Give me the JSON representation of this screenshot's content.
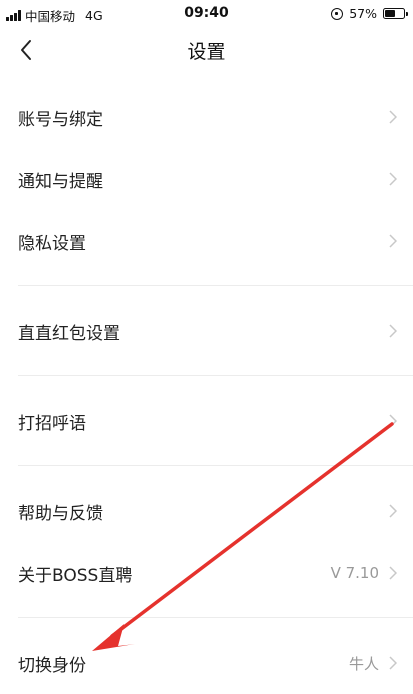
{
  "status_bar": {
    "carrier": "中国移动",
    "network": "4G",
    "time": "09:40",
    "battery_percent": "57%",
    "battery_level": 0.57
  },
  "nav": {
    "title": "设置",
    "back_icon": "chevron-left-icon"
  },
  "menu": {
    "items": [
      {
        "label": "账号与绑定",
        "value": ""
      },
      {
        "label": "通知与提醒",
        "value": ""
      },
      {
        "label": "隐私设置",
        "value": ""
      },
      {
        "label": "直直红包设置",
        "value": ""
      },
      {
        "label": "打招呼语",
        "value": ""
      },
      {
        "label": "帮助与反馈",
        "value": ""
      },
      {
        "label": "关于BOSS直聘",
        "value": "V 7.10"
      },
      {
        "label": "切换身份",
        "value": "牛人"
      }
    ]
  },
  "annotation": {
    "arrow_color": "#e5322d"
  }
}
